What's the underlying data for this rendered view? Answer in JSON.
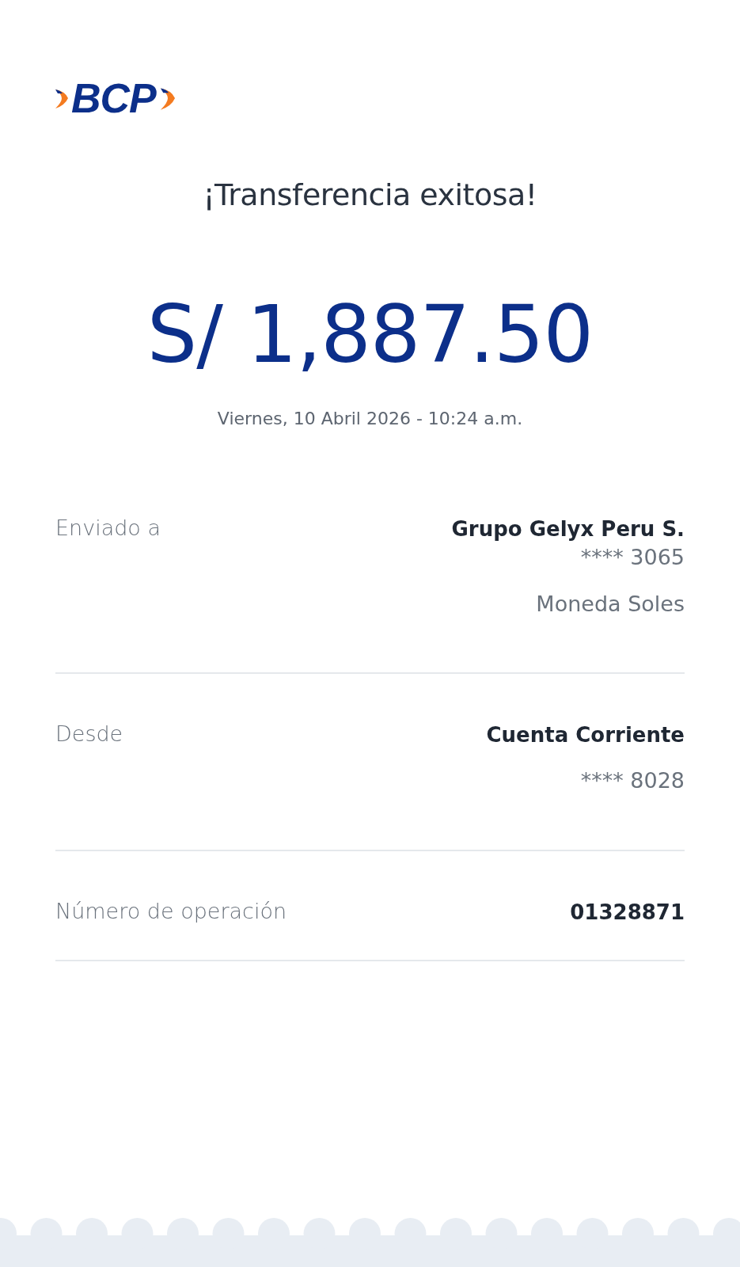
{
  "logo": {
    "text": "BCP"
  },
  "title": "¡Transferencia exitosa!",
  "amount": "S/ 1,887.50",
  "datetime": "Viernes, 10 Abril 2026 - 10:24 a.m.",
  "details": [
    {
      "label": "Enviado a",
      "lines": [
        {
          "text": "Grupo Gelyx Peru S.",
          "kind": "strong"
        },
        {
          "text": "**** 3065",
          "kind": "normal"
        },
        {
          "text": "Moneda Soles",
          "kind": "spaced"
        }
      ]
    },
    {
      "label": "Desde",
      "lines": [
        {
          "text": "Cuenta Corriente",
          "kind": "strong"
        },
        {
          "text": "**** 8028",
          "kind": "spaced"
        }
      ]
    },
    {
      "label": "Número de operación",
      "lines": [
        {
          "text": "01328871",
          "kind": "strong"
        }
      ]
    }
  ]
}
